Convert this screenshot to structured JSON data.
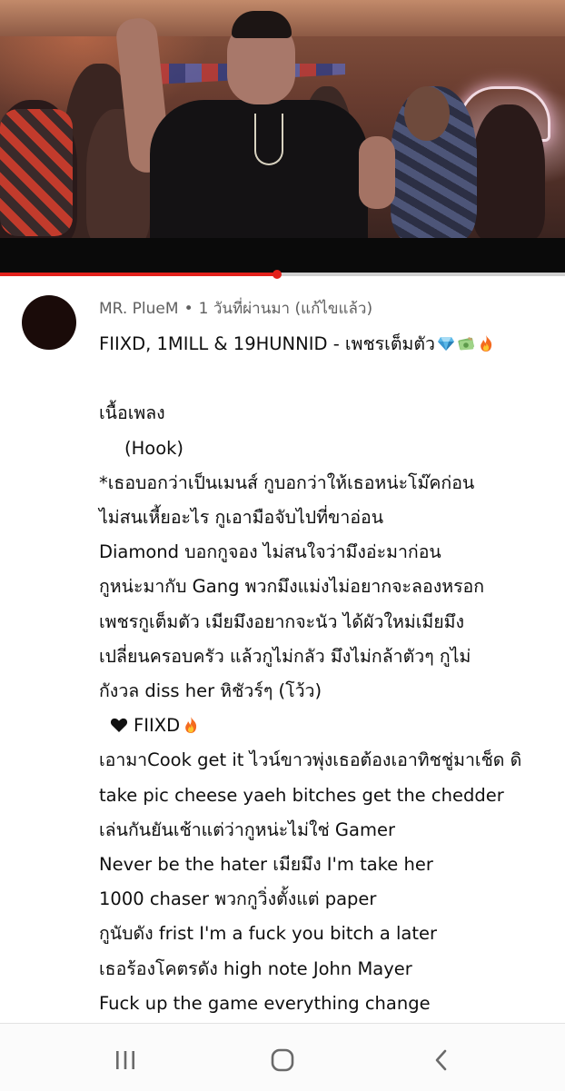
{
  "video": {
    "progress": 0.49,
    "accent_color": "#e3211b"
  },
  "comment": {
    "author": "MR. PlueM",
    "separator": "•",
    "time": "1 วันที่ผ่านมา",
    "edited": "(แก้ไขแล้ว)",
    "title": "FIIXD, 1MILL & 19HUNNID - เพชรเต็มตัว",
    "title_emojis": [
      "gem-emoji",
      "money-emoji",
      "fire-emoji"
    ],
    "lyrics_label": "เนื้อเพลง",
    "hook_label": "(Hook)",
    "lines": [
      "*เธอบอกว่าเป็นเมนส์ กูบอกว่าให้เธอหน่ะโม๊คก่อน",
      "ไม่สนเหี้ยอะไร กูเอามือจับไปที่ขาอ่อน",
      "Diamond บอกกูจอง ไม่สนใจว่ามึงอ่ะมาก่อน",
      "กูหน่ะมากับ Gang พวกมึงแม่งไม่อยากจะลองหรอก",
      "เพชรกูเต็มตัว  เมียมึงอยากจะนัว ได้ผัวใหม่เมียมึง",
      "เปลี่ยนครอบครัว แล้วกูไม่กลัว มึงไม่กล้าตัวๆ กูไม่",
      "กังวล diss her หิชัวร์ๆ (โว้ว)"
    ],
    "artist_tag": "FIIXD",
    "verse_lines": [
      "เอามาCook get it ไวน์ขาวพุ่งเธอต้องเอาทิชชู่มาเช็ด ดิ",
      "take pic cheese yaeh  bitches get the chedder",
      "เล่นกันยันเช้าแต่ว่ากูหน่ะไม่ใช่ Gamer",
      "Never be the hater เมียมึง I'm take  her",
      "1000 chaser พวกกูวิ่งตั้งแต่ paper",
      "กูนับดัง frist I'm a fuck you bitch a later",
      "เธอร้องโคตรดัง high note John Mayer",
      "Fuck up the game everything change"
    ]
  },
  "navbar": {
    "recents_icon": "recent-apps-icon",
    "home_icon": "home-icon",
    "back_icon": "back-icon"
  }
}
